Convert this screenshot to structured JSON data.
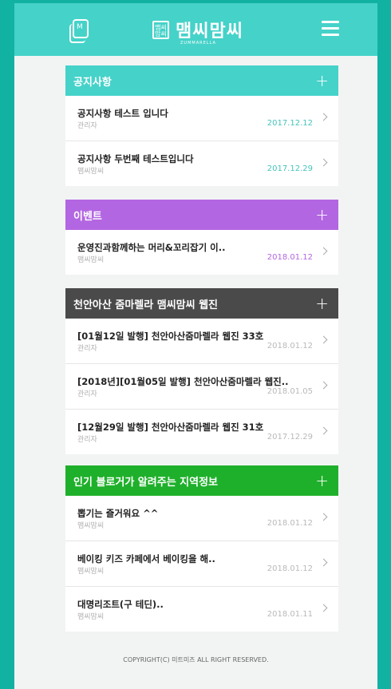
{
  "header": {
    "book_icon_letter": "M",
    "logo_mark": "맴씨\n맘씨",
    "logo_text": "맴씨맘씨",
    "logo_sub": "ZUMMARELLA"
  },
  "boards": [
    {
      "title": "공지사항",
      "color": "#45d2c9",
      "posts": [
        {
          "title": "공지사항 테스트 입니다",
          "author": "관리자",
          "date": "2017.12.12"
        },
        {
          "title": "공지사항 두번째 테스트입니다",
          "author": "맴씨맘씨",
          "date": "2017.12.29"
        }
      ]
    },
    {
      "title": "이벤트",
      "color": "#b366e2",
      "posts": [
        {
          "title": "운영진과함께하는 머리&꼬리잡기 이..",
          "author": "맴씨맘씨",
          "date": "2018.01.12"
        }
      ]
    },
    {
      "title": "천안아산 줌마렐라 맴씨맘씨 웹진",
      "color": "#4a4a4a",
      "posts": [
        {
          "title": "[01월12일 발행] 천안아산줌마렐라 웹진 33호",
          "author": "관리자",
          "date": "2018.01.12"
        },
        {
          "title": "[2018년][01월05일 발행] 천안아산줌마렐라 웹진..",
          "author": "관리자",
          "date": "2018.01.05"
        },
        {
          "title": "[12월29일 발행] 천안아산줌마렐라 웹진 31호",
          "author": "관리자",
          "date": "2017.12.29"
        }
      ]
    },
    {
      "title": "인기 블로거가 알려주는 지역정보",
      "color": "#1fb02b",
      "posts": [
        {
          "title": "뽑기는 즐거워요 ^^",
          "author": "맴씨맘씨",
          "date": "2018.01.12"
        },
        {
          "title": "베이킹 키즈 카페에서 베이킹을 해..",
          "author": "맴씨맘씨",
          "date": "2018.01.12"
        },
        {
          "title": "대명리조트(구 테딘)..",
          "author": "맴씨맘씨",
          "date": "2018.01.11"
        }
      ]
    }
  ],
  "footer": {
    "copyright": "COPYRIGHT(C) 미트미즈 ALL RIGHT RESERVED."
  }
}
